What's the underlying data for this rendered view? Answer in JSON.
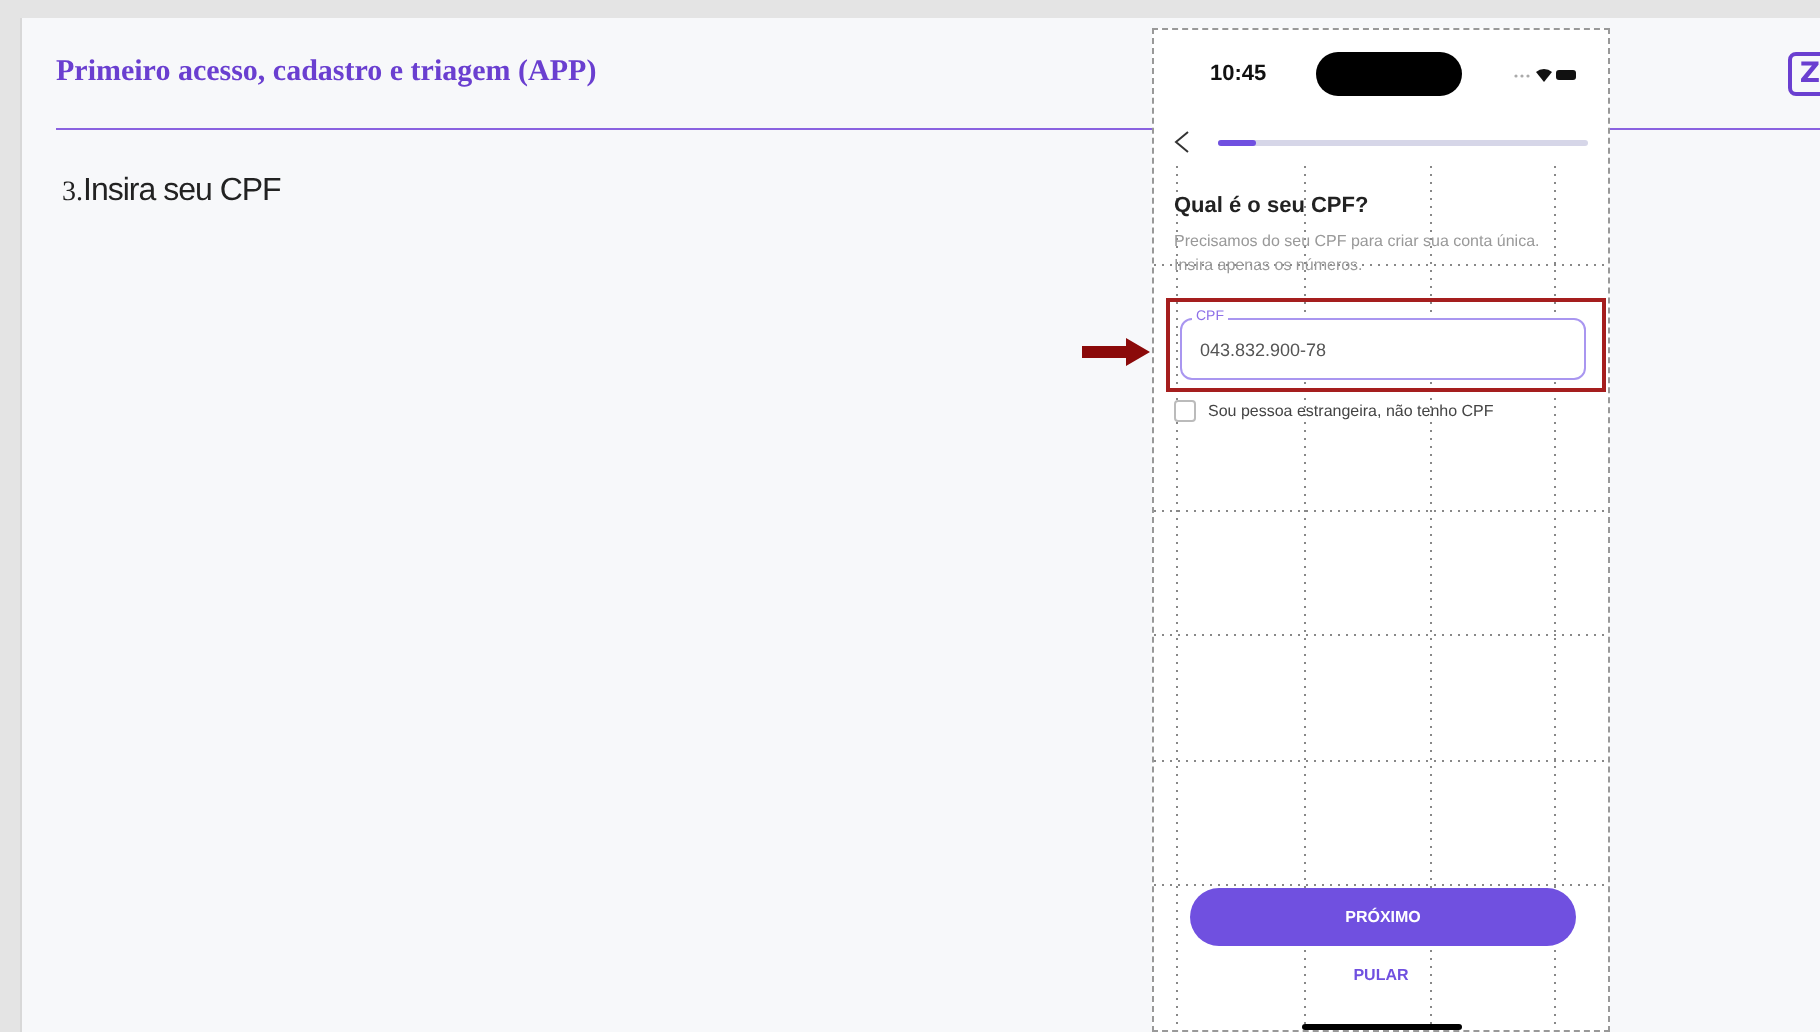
{
  "header": {
    "title": "Primeiro acesso, cadastro e triagem (APP)",
    "logo": "Z"
  },
  "step": {
    "number": "3.",
    "text": "Insira seu CPF"
  },
  "phone": {
    "time": "10:45",
    "progress": {
      "level": 0.1
    },
    "question": "Qual é o seu CPF?",
    "description": "Precisamos do seu CPF para criar sua conta única. Insira apenas os números.",
    "field": {
      "label": "CPF",
      "value": "043.832.900-78",
      "highlighted": true
    },
    "foreigner": {
      "label": "Sou pessoa estrangeira, não tenho CPF",
      "checked": false
    },
    "primary_button": "PRÓXIMO",
    "skip_link": "PULAR"
  }
}
